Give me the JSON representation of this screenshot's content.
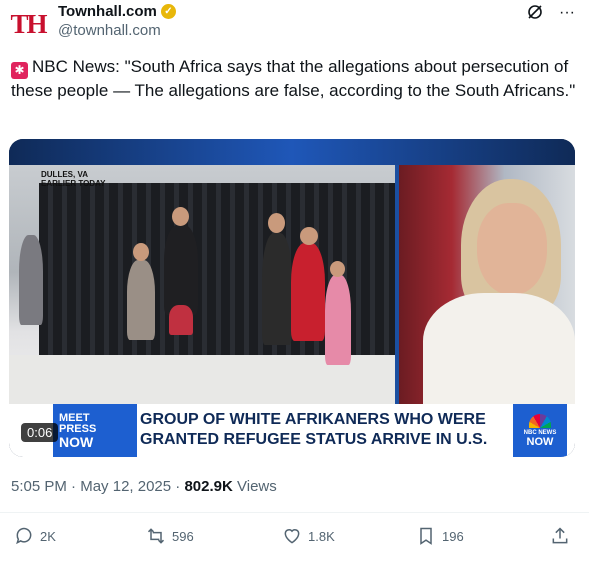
{
  "author": {
    "avatar_text": "TH",
    "name": "Townhall.com",
    "verified_icon": "gold-check-icon",
    "handle": "@townhall.com"
  },
  "header_icons": [
    "grok-icon",
    "more-icon"
  ],
  "tweet": {
    "text": "NBC News: \"South Africa says that the allegations about persecution of these people — The allegations are false, according to the South Africans.\""
  },
  "media": {
    "location_line1": "DULLES, VA",
    "location_line2": "EARLIER TODAY",
    "show_logo_line1": "MEET",
    "show_logo_line2": "PRESS",
    "show_logo_line3": "NOW",
    "headline_line1": "GROUP OF WHITE AFRIKANERS WHO WERE",
    "headline_line2": "GRANTED REFUGEE STATUS ARRIVE IN U.S.",
    "network_logo_line1": "NBC NEWS",
    "network_logo_line2": "NOW",
    "duration": "0:06"
  },
  "meta": {
    "time": "5:05 PM",
    "separator": "·",
    "date": "May 12, 2025",
    "views_count": "802.9K",
    "views_label": "Views"
  },
  "actions": {
    "replies": "2K",
    "reposts": "596",
    "likes": "1.8K",
    "bookmarks": "196"
  }
}
